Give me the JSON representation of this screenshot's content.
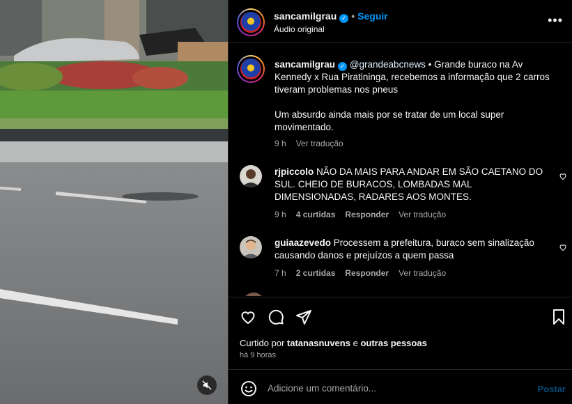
{
  "post": {
    "username": "sancamilgrau",
    "follow_label": "Seguir",
    "separator": "•",
    "audio_label": "Áudio original",
    "more_label": "•••"
  },
  "caption": {
    "username": "sancamilgrau",
    "mention": "@grandeabcnews",
    "text_line1": " • Grande buraco na Av Kennedy x Rua Piratininga, recebemos a informação que 2 carros tiveram problemas nos pneus",
    "text_line2": "Um absurdo ainda mais por se tratar de um local super movimentado.",
    "time": "9 h",
    "translate_label": "Ver tradução"
  },
  "comments": [
    {
      "username": "rjpiccolo",
      "text": "NÃO DA MAIS PARA ANDAR EM SÃO CAETANO DO SUL. CHEIO DE BURACOS, LOMBADAS MAL DIMENSIONADAS, RADARES AOS MONTES.",
      "time": "9 h",
      "likes": "4 curtidas",
      "reply_label": "Responder",
      "translate_label": "Ver tradução"
    },
    {
      "username": "guiaazevedo",
      "text": "Processem a prefeitura, buraco sem sinalização causando danos e prejuízos a quem passa",
      "time": "7 h",
      "likes": "2 curtidas",
      "reply_label": "Responder",
      "translate_label": "Ver tradução"
    }
  ],
  "actions": {
    "liked_prefix": "Curtido por ",
    "liked_user": "tatanasnuvens",
    "liked_and": " e ",
    "liked_others": "outras pessoas",
    "time_ago": "há 9 horas"
  },
  "composer": {
    "placeholder": "Adicione um comentário...",
    "post_label": "Postar"
  },
  "icons": {
    "mute": "speaker-muted-icon",
    "like": "heart-icon",
    "comment": "comment-bubble-icon",
    "share": "paper-plane-icon",
    "save": "bookmark-icon",
    "emoji": "smiley-icon",
    "more": "more-options-icon"
  },
  "colors": {
    "accent": "#0095f6",
    "background": "#000000",
    "secondary_text": "#a8a8a8",
    "divider": "#262626"
  }
}
